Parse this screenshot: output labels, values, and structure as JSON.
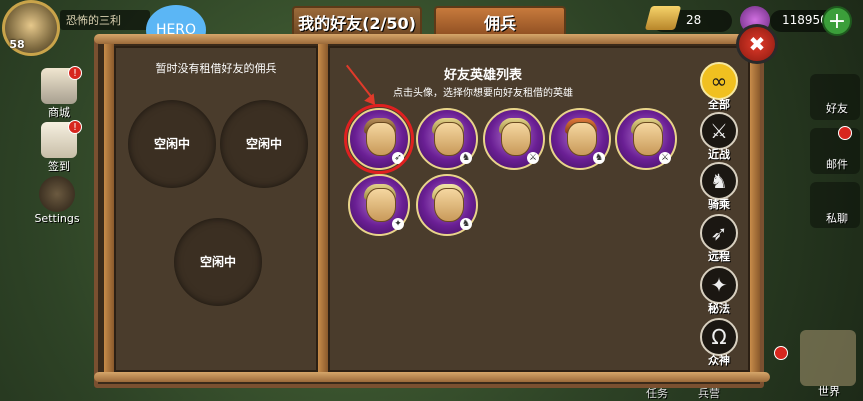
{
  "header": {
    "player_level": "58",
    "player_name": "恐怖的三利",
    "hero_badge": "HERO",
    "tabs": [
      "我的好友(2/50)",
      "佣兵"
    ],
    "gold": "28",
    "gems": "118950",
    "plus": "+"
  },
  "left_menu": [
    {
      "label": "商城",
      "badge": "!"
    },
    {
      "label": "签到",
      "badge": "!"
    },
    {
      "label": "Settings",
      "badge": ""
    }
  ],
  "right_menu": [
    {
      "label": "好友"
    },
    {
      "label": "邮件"
    },
    {
      "label": "私聊"
    }
  ],
  "bottom": {
    "left_tab": "任务",
    "mid_tab": "兵营",
    "world": "世界"
  },
  "left_panel": {
    "hint": "暂时没有租借好友的佣兵",
    "slots": [
      "空闲中",
      "空闲中",
      "空闲中"
    ]
  },
  "right_panel": {
    "title": "好友英雄列表",
    "subtitle": "点击头像，选择你想要向好友租借的英雄",
    "heroes": [
      {
        "name": "hero-1",
        "selected": true
      },
      {
        "name": "hero-2",
        "selected": false
      },
      {
        "name": "hero-3",
        "selected": false
      },
      {
        "name": "hero-4",
        "selected": false
      },
      {
        "name": "hero-5",
        "selected": false
      },
      {
        "name": "hero-6",
        "selected": false
      },
      {
        "name": "hero-7",
        "selected": false
      }
    ]
  },
  "filters": [
    {
      "label": "全部",
      "icon": "∞"
    },
    {
      "label": "近战",
      "icon": "⚔"
    },
    {
      "label": "骑乘",
      "icon": "♞"
    },
    {
      "label": "远程",
      "icon": "➶"
    },
    {
      "label": "秘法",
      "icon": "✦"
    },
    {
      "label": "众神",
      "icon": "Ω"
    }
  ],
  "close_label": "✖"
}
